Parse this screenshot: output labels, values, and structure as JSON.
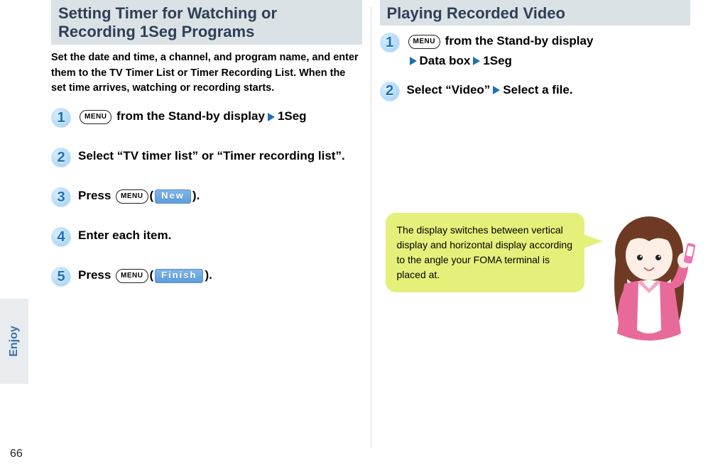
{
  "page_number": "66",
  "side_tab": "Enjoy",
  "left": {
    "title": "Setting Timer for Watching or Recording 1Seg Programs",
    "intro": "Set the date and time, a channel, and program name, and enter them to the TV Timer List or Timer Recording List. When the set time arrives, watching or recording starts.",
    "steps": {
      "s1_num": "1",
      "s1_menu": "MENU",
      "s1_a": " from the Stand-by display",
      "s1_b": "1Seg",
      "s2_num": "2",
      "s2_text": "Select “TV timer list” or “Timer recording list”.",
      "s3_num": "3",
      "s3_a": "Press ",
      "s3_menu": "MENU",
      "s3_btn": "New",
      "s3_b": "(",
      "s3_c": ").",
      "s4_num": "4",
      "s4_text": "Enter each item.",
      "s5_num": "5",
      "s5_a": "Press ",
      "s5_menu": "MENU",
      "s5_btn": "Finish",
      "s5_b": "(",
      "s5_c": ")."
    }
  },
  "right": {
    "title": "Playing Recorded Video",
    "steps": {
      "s1_num": "1",
      "s1_menu": "MENU",
      "s1_a": " from the Stand-by display",
      "s1_b": "Data box",
      "s1_c": "1Seg",
      "s2_num": "2",
      "s2_a": "Select “Video”",
      "s2_b": "Select a file."
    },
    "tip": "The display switches between vertical display and horizontal display according to the angle your FOMA terminal is placed at."
  }
}
